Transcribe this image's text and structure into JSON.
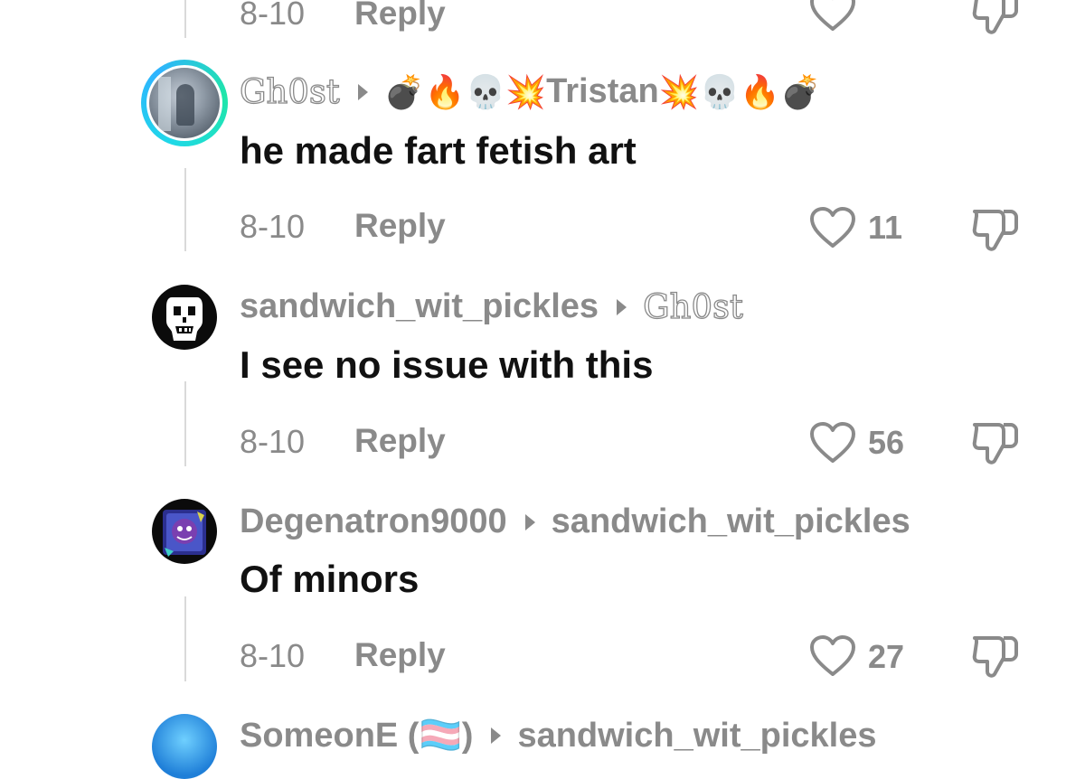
{
  "comments": [
    {
      "date": "8-10",
      "reply_label": "Reply"
    },
    {
      "author": "Gh0st",
      "replying_to": "💣🔥💀💥Tristan💥💀🔥💣",
      "replying_to_parts": {
        "prefix": "💣🔥💀💥",
        "name": "Tristan",
        "suffix": "💥💀🔥💣"
      },
      "text": "he made fart fetish art",
      "date": "8-10",
      "reply_label": "Reply",
      "likes": "11"
    },
    {
      "author": "sandwich_wit_pickles",
      "replying_to": "Gh0st",
      "text": "I see no issue with this",
      "date": "8-10",
      "reply_label": "Reply",
      "likes": "56"
    },
    {
      "author": "Degenatron9000",
      "replying_to": "sandwich_wit_pickles",
      "text": "Of minors",
      "date": "8-10",
      "reply_label": "Reply",
      "likes": "27"
    },
    {
      "author": "SomeonE (🏳️‍⚧️)",
      "replying_to": "sandwich_wit_pickles"
    }
  ],
  "colors": {
    "meta_text": "#8a8a8a",
    "body_text": "#111111",
    "story_ring": "#1fd8e8",
    "thread_line": "#d9d9d9"
  },
  "icons": [
    "heart-icon",
    "thumbs-down-icon",
    "reply-arrow-icon"
  ]
}
